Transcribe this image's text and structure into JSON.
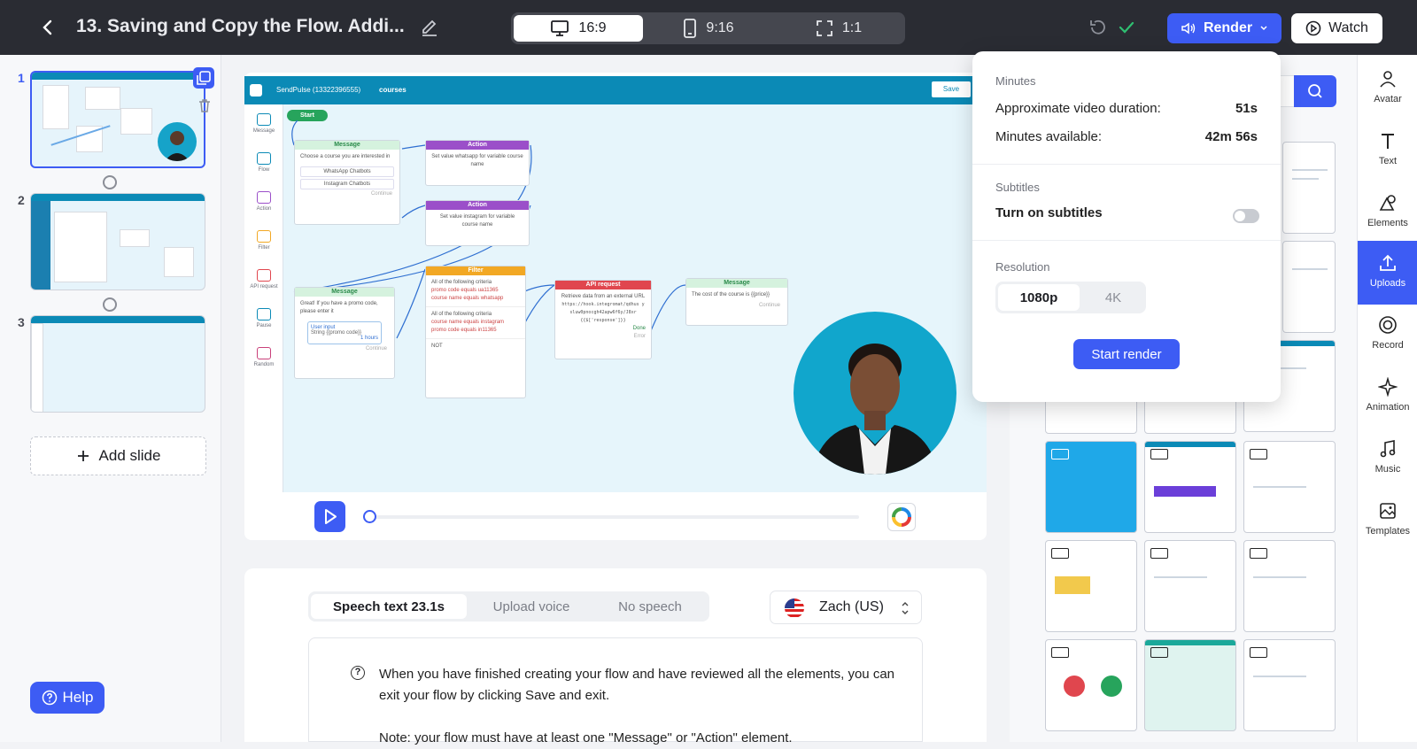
{
  "header": {
    "title": "13. Saving and Copy the Flow. Addi...",
    "ratios": [
      {
        "label": "16:9",
        "icon": "monitor-icon",
        "selected": true
      },
      {
        "label": "9:16",
        "icon": "phone-icon",
        "selected": false
      },
      {
        "label": "1:1",
        "icon": "expand-icon",
        "selected": false
      }
    ],
    "render_label": "Render",
    "watch_label": "Watch",
    "accent": "#3d5cf4"
  },
  "slides": {
    "items": [
      {
        "num": "1"
      },
      {
        "num": "2"
      },
      {
        "num": "3"
      }
    ],
    "add_label": "Add slide"
  },
  "help_label": "Help",
  "flow": {
    "app_name": "SendPulse (13322396555)",
    "flow_name": "courses",
    "save_label": "Save",
    "start_label": "Start",
    "tools": [
      "Message",
      "Flow",
      "Action",
      "Filter",
      "API request",
      "Pause",
      "Random"
    ],
    "nodes": {
      "message1": {
        "title": "Message",
        "text": "Choose a course you are interested in",
        "btn1": "WhatsApp Chatbots",
        "btn2": "Instagram Chatbots",
        "cont": "Continue"
      },
      "action1": {
        "title": "Action",
        "text": "Set value whatsapp for variable course name"
      },
      "action2": {
        "title": "Action",
        "text": "Set value instagram for variable course name"
      },
      "message2": {
        "title": "Message",
        "text": "Great! If you have a promo code, please enter it",
        "input": "User input",
        "input_sub": "String {{promo code}}",
        "time": "1 hours",
        "cont": "Continue"
      },
      "filter": {
        "title": "Filter",
        "c1": "All of the following criteria",
        "c1a": "promo code equals ua11365",
        "c1b": "course name equals whatsapp",
        "c2": "All of the following criteria",
        "c2a": "course name equals instagram",
        "c2b": "promo code equals in11365",
        "not": "NOT"
      },
      "api": {
        "title": "API request",
        "text": "Retrieve data from an external URL",
        "url": "https://hook.integromat/qdhus ysluw0pnocgh42apw6f6y/J8xr",
        "resp": "{{$['response']}}",
        "done": "Done",
        "error": "Error"
      },
      "message3": {
        "title": "Message",
        "text": "The cost of the course is {{price}}",
        "cont": "Continue"
      }
    }
  },
  "speech": {
    "tabs": [
      {
        "label": "Speech text 23.1s",
        "selected": true
      },
      {
        "label": "Upload voice",
        "selected": false
      },
      {
        "label": "No speech",
        "selected": false
      }
    ],
    "voice_name": "Zach (US)",
    "paragraph1": "When you have finished creating your flow and have reviewed all the elements, you can exit your flow by clicking Save and exit.",
    "paragraph2": "Note: your flow must have at least one \"Message\" or \"Action\" element."
  },
  "render_popover": {
    "minutes_caption": "Minutes",
    "duration_label": "Approximate video duration:",
    "duration_value": "51s",
    "available_label": "Minutes available:",
    "available_value": "42m 56s",
    "subtitles_caption": "Subtitles",
    "subtitles_label": "Turn on subtitles",
    "subtitles_on": false,
    "resolution_caption": "Resolution",
    "resolutions": [
      {
        "label": "1080p",
        "selected": true
      },
      {
        "label": "4K",
        "selected": false
      }
    ],
    "start_label": "Start render"
  },
  "sidebar_tools": [
    {
      "label": "Avatar",
      "icon": "avatar-icon",
      "selected": false
    },
    {
      "label": "Text",
      "icon": "text-icon",
      "selected": false
    },
    {
      "label": "Elements",
      "icon": "elements-icon",
      "selected": false
    },
    {
      "label": "Uploads",
      "icon": "upload-icon",
      "selected": true
    },
    {
      "label": "Record",
      "icon": "record-icon",
      "selected": false
    },
    {
      "label": "Animation",
      "icon": "animation-icon",
      "selected": false
    },
    {
      "label": "Music",
      "icon": "music-icon",
      "selected": false
    },
    {
      "label": "Templates",
      "icon": "templates-icon",
      "selected": false
    }
  ]
}
